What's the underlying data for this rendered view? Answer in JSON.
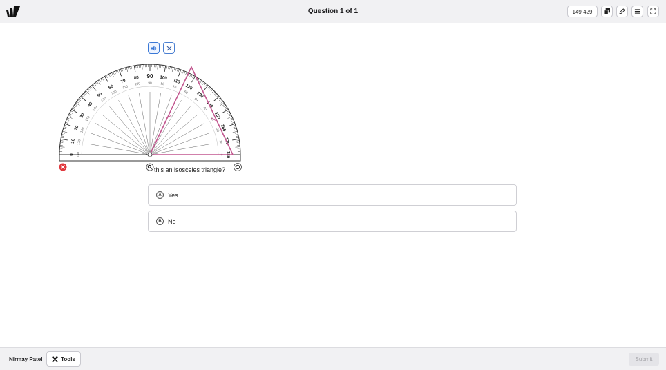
{
  "header": {
    "title": "Question 1 of 1",
    "counter": "149 429",
    "icons": [
      "copy-icon",
      "pencil-icon",
      "menu-icon",
      "fullscreen-icon"
    ]
  },
  "toolbar": {
    "icons": [
      "speaker-icon",
      "close-icon"
    ]
  },
  "protractor": {
    "outer_labels": [
      "0",
      "10",
      "20",
      "30",
      "40",
      "50",
      "60",
      "70",
      "80",
      "90",
      "100",
      "110",
      "120",
      "130",
      "140",
      "150",
      "160",
      "170",
      "180"
    ],
    "inner_labels": [
      "180",
      "170",
      "160",
      "150",
      "140",
      "130",
      "120",
      "110",
      "100",
      "90",
      "80",
      "70",
      "60",
      "50",
      "40",
      "30",
      "20",
      "10",
      "0"
    ],
    "triangle_color": "#c2578f"
  },
  "question": {
    "text": "this an isosceles triangle?"
  },
  "options": [
    {
      "letter": "A",
      "text": "Yes"
    },
    {
      "letter": "B",
      "text": "No"
    }
  ],
  "footer": {
    "user": "Nirmay Patel",
    "tools_label": "Tools",
    "submit_label": "Submit"
  },
  "colors": {
    "accent": "#3a78d6",
    "close_red": "#e0393e",
    "topbar": "#f1f1f3"
  }
}
